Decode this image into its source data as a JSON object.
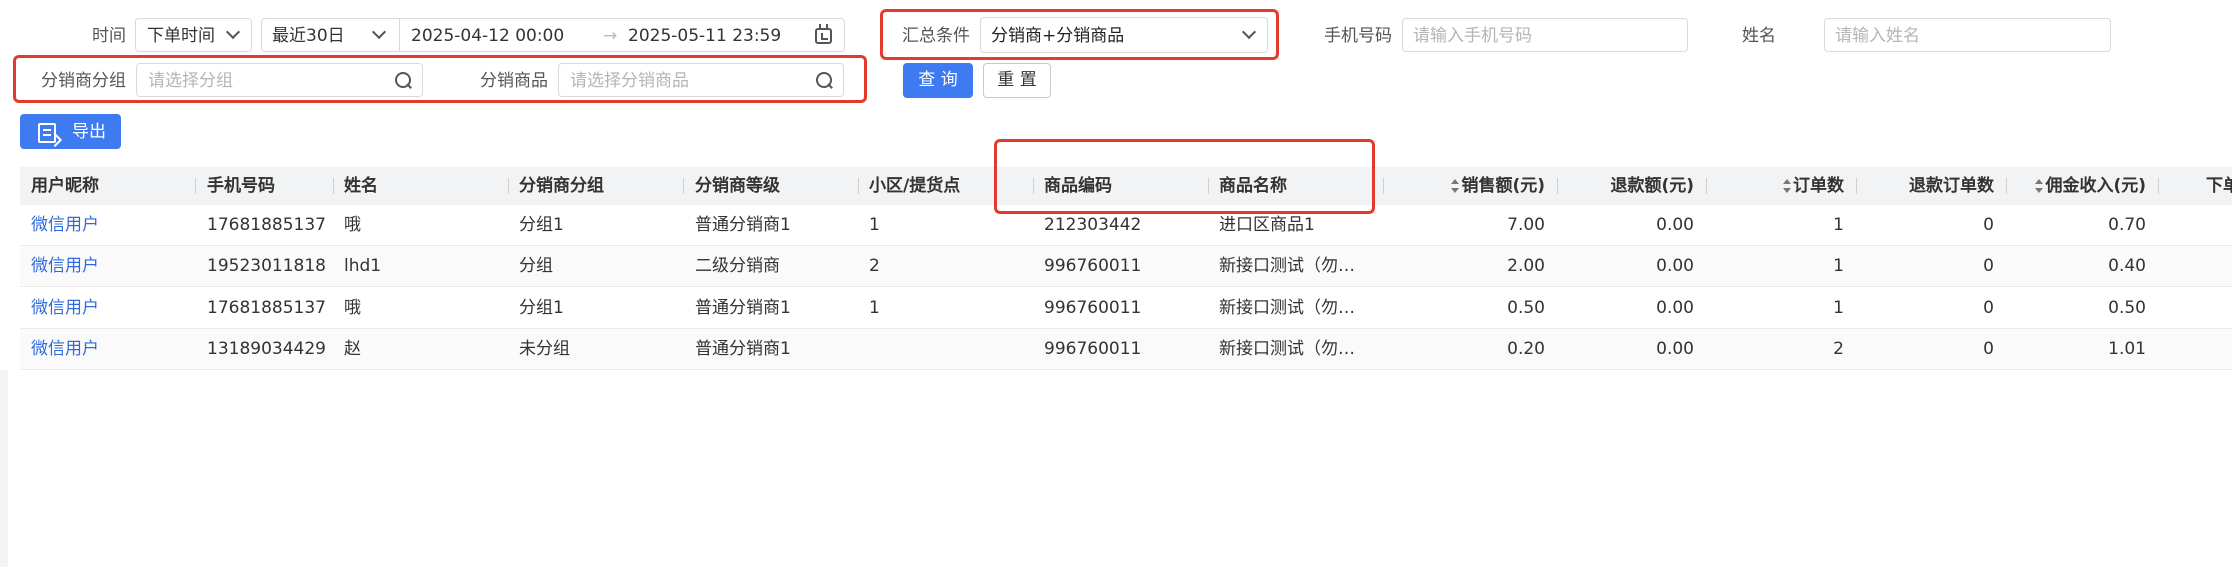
{
  "filters": {
    "time_label": "时间",
    "time_type": "下单时间",
    "time_range": "最近30日",
    "start_date": "2025-04-12 00:00",
    "end_date": "2025-05-11 23:59",
    "summary_label": "汇总条件",
    "summary_value": "分销商+分销商品",
    "phone_label": "手机号码",
    "phone_placeholder": "请输入手机号码",
    "name_label": "姓名",
    "name_placeholder": "请输入姓名",
    "group_label": "分销商分组",
    "group_placeholder": "请选择分组",
    "product_label": "分销商品",
    "product_placeholder": "请选择分销商品",
    "query_button": "查 询",
    "reset_button": "重 置"
  },
  "toolbar": {
    "export_button": "导出"
  },
  "table": {
    "columns": [
      "用户昵称",
      "手机号码",
      "姓名",
      "分销商分组",
      "分销商等级",
      "小区/提货点",
      "商品编码",
      "商品名称",
      "销售额(元)",
      "退款额(元)",
      "订单数",
      "退款订单数",
      "佣金收入(元)",
      "下单"
    ],
    "rows": [
      [
        "微信用户",
        "17681885137",
        "哦",
        "分组1",
        "普通分销商1",
        "1",
        "212303442",
        "进口区商品1",
        "7.00",
        "0.00",
        "1",
        "0",
        "0.70"
      ],
      [
        "微信用户",
        "19523011818",
        "lhd1",
        "分组",
        "二级分销商",
        "2",
        "996760011",
        "新接口测试（勿…",
        "2.00",
        "0.00",
        "1",
        "0",
        "0.40"
      ],
      [
        "微信用户",
        "17681885137",
        "哦",
        "分组1",
        "普通分销商1",
        "1",
        "996760011",
        "新接口测试（勿…",
        "0.50",
        "0.00",
        "1",
        "0",
        "0.50"
      ],
      [
        "微信用户",
        "13189034429",
        "赵",
        "未分组",
        "普通分销商1",
        "",
        "996760011",
        "新接口测试（勿…",
        "0.20",
        "0.00",
        "2",
        "0",
        "1.01"
      ]
    ]
  },
  "colors": {
    "primary": "#3e7bf0",
    "highlight_frame": "#e23b2e",
    "link": "#2f6bdc"
  }
}
